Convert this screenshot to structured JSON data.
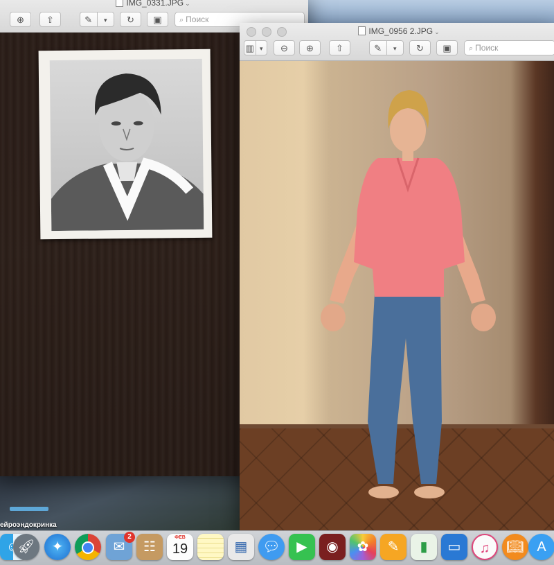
{
  "windows": [
    {
      "title": "IMG_0331.JPG",
      "search_placeholder": "Поиск"
    },
    {
      "title": "IMG_0956 2.JPG",
      "search_placeholder": "Поиск"
    }
  ],
  "desktop": {
    "label": "ейроэндокринка"
  },
  "dock": {
    "items": [
      {
        "name": "finder",
        "icon": "finder-icon"
      },
      {
        "name": "launchpad",
        "icon": "rocket-icon"
      },
      {
        "name": "safari",
        "icon": "compass-icon"
      },
      {
        "name": "chrome",
        "icon": "chrome-icon"
      },
      {
        "name": "mail",
        "icon": "mail-stamp-icon",
        "badge": "2"
      },
      {
        "name": "contacts",
        "icon": "contacts-book-icon"
      },
      {
        "name": "calendar",
        "icon": "calendar-icon",
        "month": "ФЕВ",
        "day": "19"
      },
      {
        "name": "notes",
        "icon": "notes-icon"
      },
      {
        "name": "preview",
        "icon": "preview-icon"
      },
      {
        "name": "messages",
        "icon": "speech-bubble-icon"
      },
      {
        "name": "facetime",
        "icon": "video-camera-icon"
      },
      {
        "name": "photo-booth",
        "icon": "photo-booth-icon"
      },
      {
        "name": "photos",
        "icon": "photos-flower-icon"
      },
      {
        "name": "pages",
        "icon": "pages-icon"
      },
      {
        "name": "numbers",
        "icon": "numbers-chart-icon"
      },
      {
        "name": "keynote",
        "icon": "keynote-icon"
      },
      {
        "name": "itunes",
        "icon": "music-note-icon"
      },
      {
        "name": "ibooks",
        "icon": "book-icon"
      },
      {
        "name": "app-store",
        "icon": "app-store-icon"
      }
    ]
  },
  "colors": {
    "badge": "#e0342c",
    "dock_bg": "#c6c9cd"
  }
}
